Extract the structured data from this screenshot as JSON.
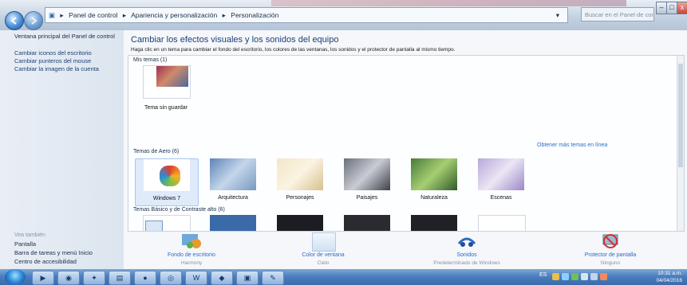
{
  "window": {
    "breadcrumb": [
      "Panel de control",
      "Apariencia y personalización",
      "Personalización"
    ],
    "search_placeholder": "Buscar en el Panel de control",
    "controls": {
      "minimize": "–",
      "maximize": "□",
      "close": "x"
    }
  },
  "sidebar": {
    "home_link": "Ventana principal del Panel de control",
    "links": [
      "Cambiar iconos del escritorio",
      "Cambiar punteros del mouse",
      "Cambiar la imagen de la cuenta"
    ],
    "see_also_header": "Vea también",
    "see_also": [
      "Pantalla",
      "Barra de tareas y menú Inicio",
      "Centro de accesibilidad"
    ]
  },
  "main": {
    "title": "Cambiar los efectos visuales y los sonidos del equipo",
    "subtitle": "Haga clic en un tema para cambiar el fondo del escritorio, los colores de las ventanas, los sonidos y el protector de pantalla al mismo tiempo.",
    "groups": {
      "my_themes": {
        "header": "Mis temas (1)",
        "items": [
          {
            "label": "Tema sin guardar"
          }
        ]
      },
      "aero_themes": {
        "header": "Temas de Aero (6)",
        "items": [
          {
            "label": "Windows 7"
          },
          {
            "label": "Arquitectura"
          },
          {
            "label": "Personajes"
          },
          {
            "label": "Paisajes"
          },
          {
            "label": "Naturaleza"
          },
          {
            "label": "Escenas"
          }
        ]
      },
      "basic_themes": {
        "header": "Temas Básico y de Contraste alto (6)"
      }
    },
    "get_more_link": "Obtener más temas en línea"
  },
  "bottom": {
    "desktop_background": {
      "label": "Fondo de escritorio",
      "value": "Harmony"
    },
    "window_color": {
      "label": "Color de ventana",
      "value": "Cielo"
    },
    "sounds": {
      "label": "Sonidos",
      "value": "Predeterminado de Windows"
    },
    "screensaver": {
      "label": "Protector de pantalla",
      "value": "Ninguno"
    }
  },
  "taskbar": {
    "clock_time": "10:31 a.m.",
    "clock_date": "04/04/2016",
    "lang": "ES"
  }
}
